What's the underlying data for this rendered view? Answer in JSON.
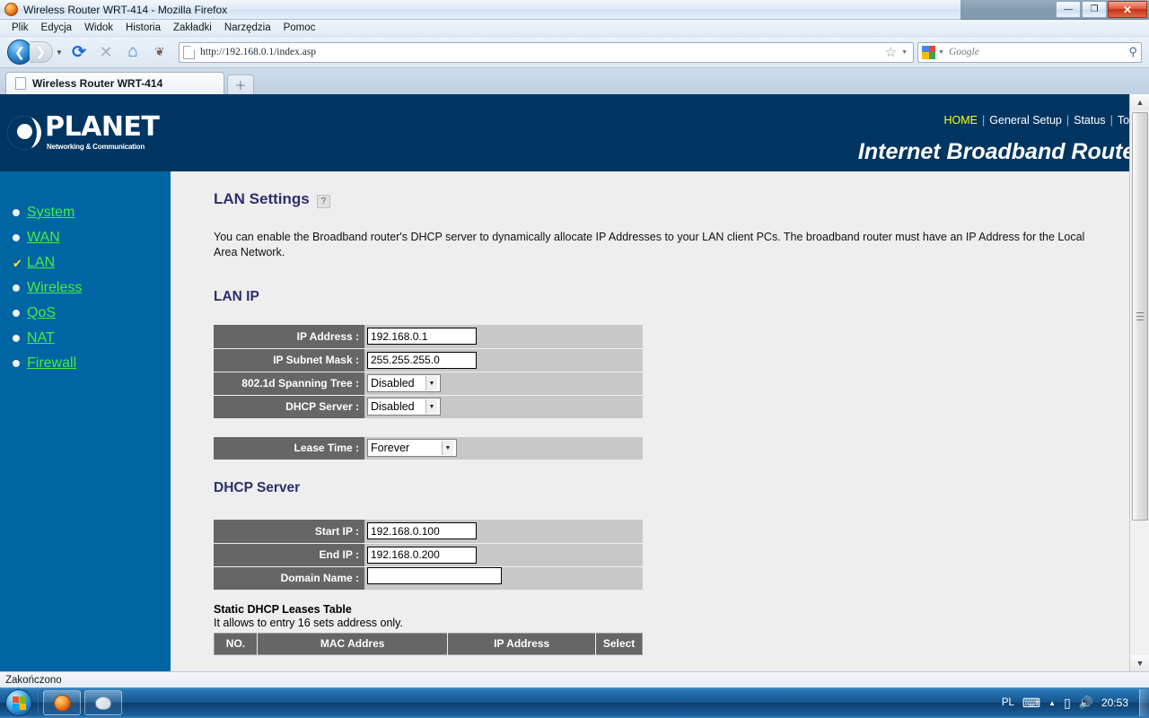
{
  "window": {
    "title": "Wireless Router WRT-414 - Mozilla Firefox",
    "minimize_label": "—",
    "restore_label": "❐",
    "close_label": "✕"
  },
  "menubar": {
    "items": [
      {
        "label": "Plik"
      },
      {
        "label": "Edycja"
      },
      {
        "label": "Widok"
      },
      {
        "label": "Historia"
      },
      {
        "label": "Zakładki"
      },
      {
        "label": "Narzędzia"
      },
      {
        "label": "Pomoc"
      }
    ]
  },
  "toolbar": {
    "back_glyph": "❮",
    "forward_glyph": "❯",
    "history_dropdown_glyph": "▼",
    "reload_glyph": "⟳",
    "stop_glyph": "✕",
    "home_glyph": "⌂",
    "feeds_glyph": "❦",
    "url": "http://192.168.0.1/index.asp",
    "star_glyph": "☆",
    "star_caret_glyph": "▼",
    "search_placeholder": "Google",
    "search_caret_glyph": "▼",
    "search_go_glyph": "⚲"
  },
  "tabs": {
    "items": [
      {
        "label": "Wireless Router WRT-414"
      }
    ],
    "new_tab_glyph": "＋"
  },
  "router": {
    "brand_name": "PLANET",
    "brand_tagline": "Networking & Communication",
    "subtitle": "Internet Broadband Router",
    "topnav": [
      {
        "label": "HOME",
        "active": true
      },
      {
        "label": "General Setup",
        "active": false
      },
      {
        "label": "Status",
        "active": false
      },
      {
        "label": "Tools",
        "active": false
      }
    ],
    "topnav_separator": "|"
  },
  "sidebar": {
    "items": [
      {
        "label": "System",
        "selected": false
      },
      {
        "label": "WAN",
        "selected": false
      },
      {
        "label": "LAN",
        "selected": true
      },
      {
        "label": "Wireless",
        "selected": false
      },
      {
        "label": "QoS",
        "selected": false
      },
      {
        "label": "NAT",
        "selected": false
      },
      {
        "label": "Firewall",
        "selected": false
      }
    ],
    "check_glyph": "✔"
  },
  "page": {
    "title": "LAN Settings",
    "help_glyph": "?",
    "description": "You can enable the Broadband router's DHCP server to dynamically allocate IP Addresses to your LAN client PCs. The broadband router must have an IP Address for the Local Area Network.",
    "lan_ip": {
      "heading": "LAN IP",
      "rows": [
        {
          "label": "IP Address :",
          "type": "text",
          "value": "192.168.0.1"
        },
        {
          "label": "IP Subnet Mask :",
          "type": "text",
          "value": "255.255.255.0"
        },
        {
          "label": "802.1d Spanning Tree :",
          "type": "select",
          "value": "Disabled"
        },
        {
          "label": "DHCP Server :",
          "type": "select",
          "value": "Disabled"
        }
      ],
      "lease_row": {
        "label": "Lease Time :",
        "type": "select",
        "value": "Forever"
      }
    },
    "dhcp_server": {
      "heading": "DHCP Server",
      "rows": [
        {
          "label": "Start IP :",
          "type": "text",
          "value": "192.168.0.100"
        },
        {
          "label": "End IP :",
          "type": "text",
          "value": "192.168.0.200"
        },
        {
          "label": "Domain Name :",
          "type": "text",
          "value": ""
        }
      ]
    },
    "leases_table": {
      "title": "Static DHCP Leases Table",
      "subtitle": "It allows to entry 16 sets address only.",
      "columns": [
        "NO.",
        "MAC Addres",
        "IP Address",
        "Select"
      ]
    },
    "select_caret_glyph": "▼"
  },
  "scrollbar": {
    "up_glyph": "▲",
    "down_glyph": "▼"
  },
  "statusbar": {
    "text": "Zakończono"
  },
  "taskbar": {
    "buttons": [
      {
        "name": "firefox",
        "glyph": "●"
      },
      {
        "name": "paint",
        "glyph": "◐"
      }
    ],
    "tray": {
      "language": "PL",
      "keyboard_glyph": "⌨",
      "overflow_glyph": "▲",
      "battery_glyph": "▯",
      "volume_glyph": "🔊",
      "clock": "20:53"
    }
  },
  "colors": {
    "header_navy": "#003562",
    "sidebar_blue": "#0065a3",
    "link_green": "#44ee44",
    "active_yellow": "#ffff00",
    "label_gray": "#666666",
    "field_gray": "#c8c8c8",
    "heading_navy": "#2b2f6b"
  }
}
